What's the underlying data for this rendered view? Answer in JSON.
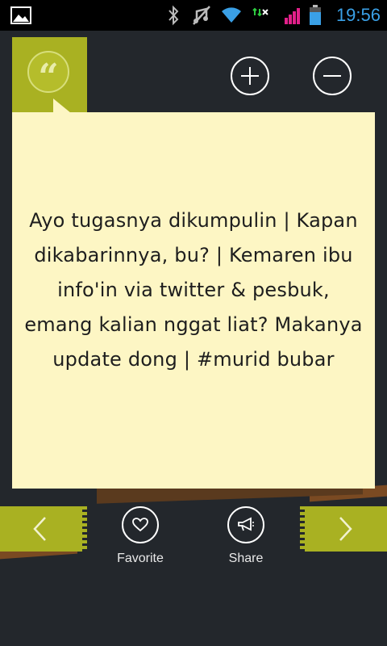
{
  "status_bar": {
    "time": "19:56",
    "icons": [
      "gallery-icon",
      "bluetooth-icon",
      "mute-icon",
      "wifi-icon",
      "data-arrows-icon",
      "signal-icon",
      "battery-icon"
    ],
    "colors": {
      "time": "#3aa0e6",
      "signal": "#e3208a",
      "battery": "#3aa0e6",
      "data": "#2ecc40"
    }
  },
  "header": {
    "quote_icon": "quote-icon",
    "quote_symbol": "“",
    "zoom_in_icon": "plus-icon",
    "zoom_out_icon": "minus-icon"
  },
  "quote": {
    "text": "Ayo tugasnya dikumpulin | Kapan dikabarinnya, bu? | Kemaren ibu info'in via twitter & pesbuk, emang kalian nggat liat? Makanya update dong | #murid bubar"
  },
  "bottom_bar": {
    "prev_icon": "chevron-left-icon",
    "next_icon": "chevron-right-icon",
    "favorite_label": "Favorite",
    "share_label": "Share"
  },
  "colors": {
    "background": "#23272c",
    "accent": "#a9b122",
    "card": "#fdf6c4",
    "wood": "#7a4a22"
  }
}
